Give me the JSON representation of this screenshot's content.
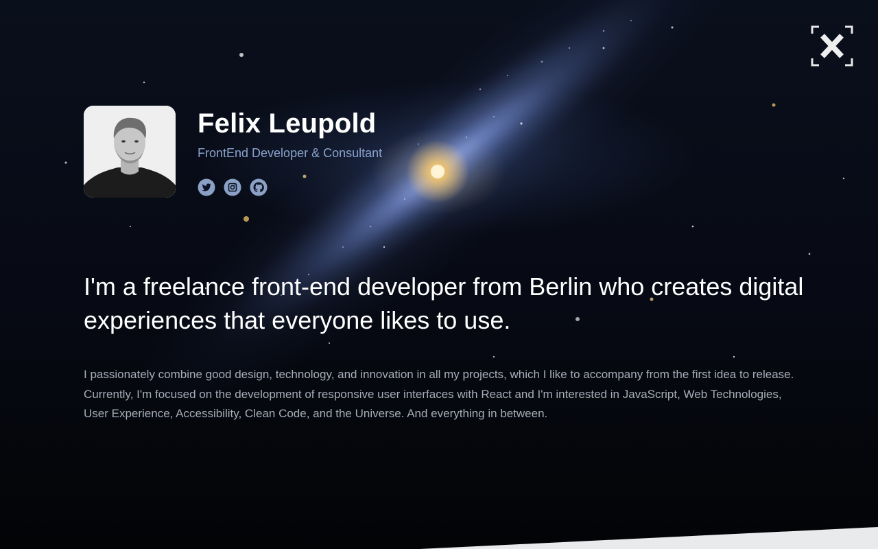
{
  "profile": {
    "name": "Felix Leupold",
    "role": "FrontEnd Developer & Consultant",
    "avatar_alt": "Portrait photo of Felix Leupold"
  },
  "socials": [
    {
      "icon": "twitter-icon",
      "label": "Twitter"
    },
    {
      "icon": "instagram-icon",
      "label": "Instagram"
    },
    {
      "icon": "github-icon",
      "label": "GitHub"
    }
  ],
  "headline": "I'm a freelance front-end developer from Berlin who creates digital experiences that everyone likes to use.",
  "bio": "I passionately combine good design, technology, and innovation in all my projects, which I like to accompany from the first idea to release. Currently, I'm focused on the development of responsive user interfaces with React and I'm interested in JavaScript, Web Technologies, User Experience, Accessibility, Clean Code, and the Universe. And everything in between.",
  "close": {
    "icon": "close-icon",
    "label": "Close"
  },
  "colors": {
    "background": "#05070d",
    "role_text": "#8aa2cc",
    "icon_color": "#8aa0c4",
    "bio_text": "#a7adb8",
    "bottom_wedge": "#e9eaec"
  }
}
